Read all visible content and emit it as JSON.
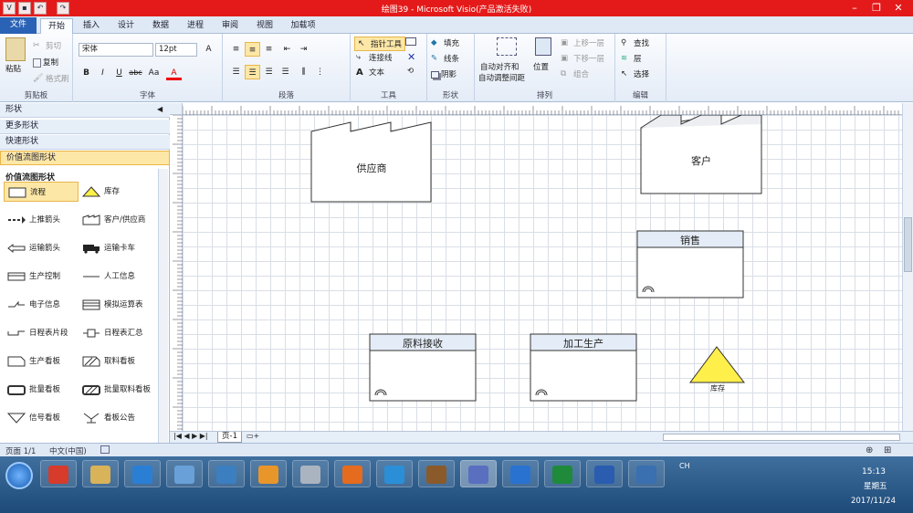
{
  "window": {
    "title": "绘图39 - Microsoft Visio(产品激活失败)"
  },
  "quick_access": {
    "save_icon": "save-icon",
    "undo_icon": "undo-icon",
    "redo_icon": "redo-icon"
  },
  "tabs": [
    "文件",
    "开始",
    "插入",
    "设计",
    "数据",
    "进程",
    "审阅",
    "视图",
    "加载项"
  ],
  "ribbon": {
    "clipboard": {
      "paste": "粘贴",
      "cut": "剪切",
      "copy": "复制",
      "format_painter": "格式刷",
      "label": "剪贴板"
    },
    "font": {
      "name": "宋体",
      "size": "12pt",
      "bold": "B",
      "italic": "I",
      "underline": "U",
      "strike": "abc",
      "case": "Aa",
      "color": "A",
      "label": "字体"
    },
    "paragraph": {
      "label": "段落"
    },
    "tools": {
      "pointer": "指针工具",
      "connector": "连接线",
      "text": "文本",
      "label": "工具"
    },
    "shape": {
      "fill": "填充",
      "line": "线条",
      "shadow": "阴影",
      "label": "形状"
    },
    "arrange": {
      "auto_align": "自动对齐和",
      "auto_space": "自动调整间距",
      "position": "位置",
      "bring_forward": "上移一层",
      "send_backward": "下移一层",
      "group": "组合",
      "label": "排列"
    },
    "editing": {
      "find": "查找",
      "layers": "层",
      "select": "选择",
      "label": "编辑"
    }
  },
  "shapes_panel": {
    "title": "形状",
    "more": "更多形状",
    "quick": "快速形状",
    "stencil_active": "价值流图形状",
    "stencil_title": "价值流图形状",
    "items": [
      {
        "label": "流程",
        "icon": "process-icon"
      },
      {
        "label": "库存",
        "icon": "inventory-triangle-icon"
      },
      {
        "label": "上推箭头",
        "icon": "push-arrow-icon"
      },
      {
        "label": "客户/供应商",
        "icon": "factory-icon"
      },
      {
        "label": "运输箭头",
        "icon": "shipment-arrow-icon"
      },
      {
        "label": "运输卡车",
        "icon": "truck-icon"
      },
      {
        "label": "生产控制",
        "icon": "production-control-icon"
      },
      {
        "label": "人工信息",
        "icon": "manual-info-icon"
      },
      {
        "label": "电子信息",
        "icon": "electronic-info-icon"
      },
      {
        "label": "模拟运算表",
        "icon": "data-table-icon"
      },
      {
        "label": "日程表片段",
        "icon": "timeline-segment-icon"
      },
      {
        "label": "日程表汇总",
        "icon": "timeline-total-icon"
      },
      {
        "label": "生产看板",
        "icon": "production-kanban-icon"
      },
      {
        "label": "取料看板",
        "icon": "withdrawal-kanban-icon"
      },
      {
        "label": "批量看板",
        "icon": "batch-kanban-icon"
      },
      {
        "label": "批量取料看板",
        "icon": "batch-withdrawal-kanban-icon"
      },
      {
        "label": "信号看板",
        "icon": "signal-kanban-icon"
      },
      {
        "label": "看板公告",
        "icon": "kanban-post-icon"
      }
    ]
  },
  "diagram": {
    "supplier": "供应商",
    "customer": "客户",
    "sales": "销售",
    "receiving": "原料接收",
    "manufacturing": "加工生产",
    "inventory": "库存"
  },
  "page_tab": "页-1",
  "status": {
    "page": "页面 1/1",
    "language": "中文(中国)"
  },
  "taskbar": {
    "apps": [
      "360",
      "文件夹",
      "IE",
      "画笔",
      "便签",
      "看图",
      "计算器",
      "Firefox",
      "视频",
      "地图",
      "Visio",
      "笔记",
      "Excel",
      "Word",
      "远程"
    ],
    "tray_lang": "CH",
    "time": "15:13",
    "weekday": "星期五",
    "date": "2017/11/24"
  },
  "colors": {
    "title_bar": "#e41a1a",
    "file_tab": "#2a62b5",
    "inventory_fill": "#ffef4a",
    "process_header": "#e4ecf7"
  }
}
